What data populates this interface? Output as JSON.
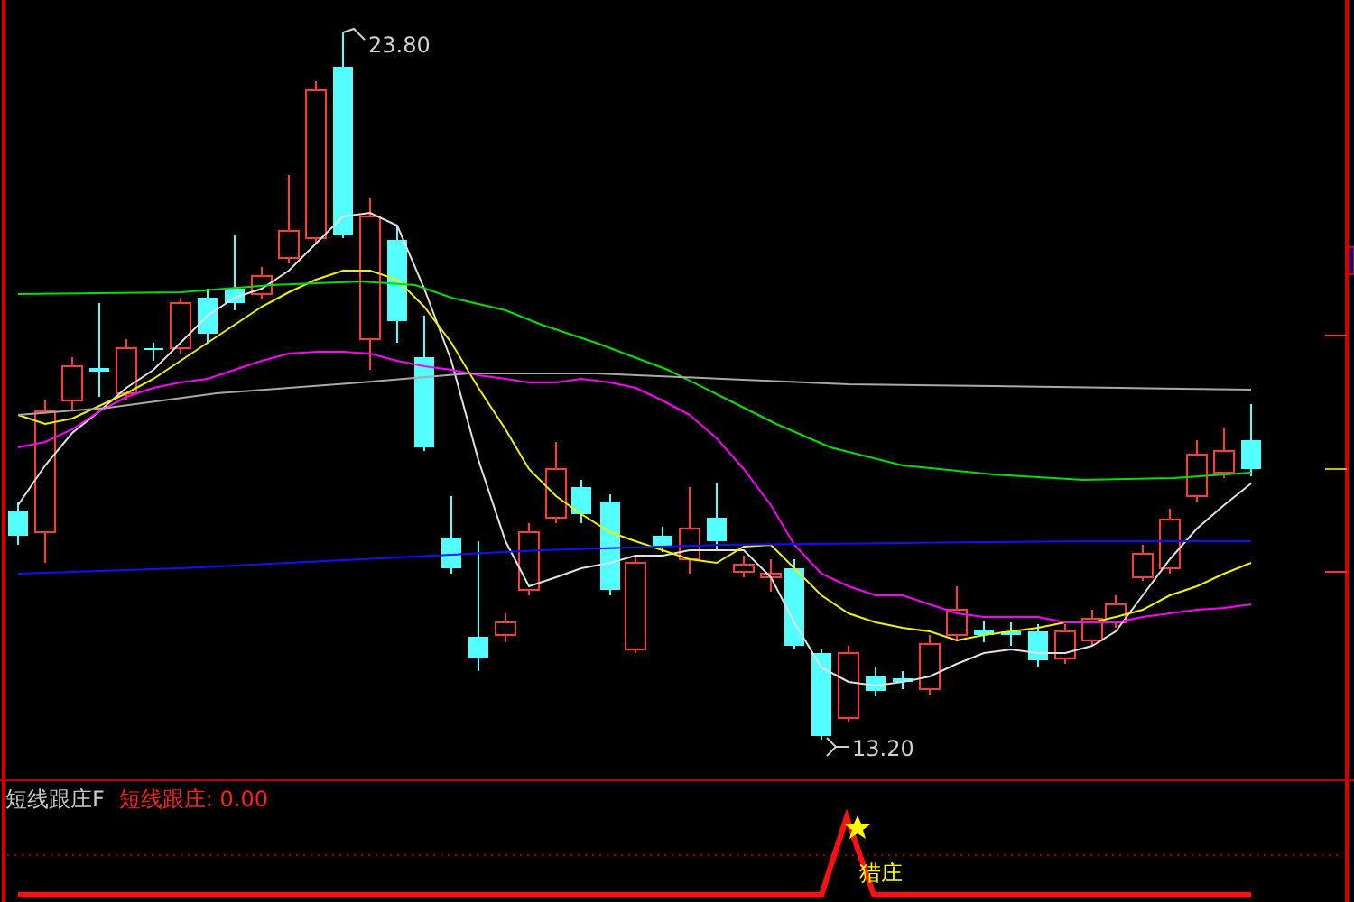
{
  "price_chart": {
    "high_label": "23.80",
    "low_label": "13.20"
  },
  "indicator": {
    "name": "短线跟庄F",
    "series_label": "短线跟庄: 0.00",
    "signal_label": "猎庄"
  }
}
